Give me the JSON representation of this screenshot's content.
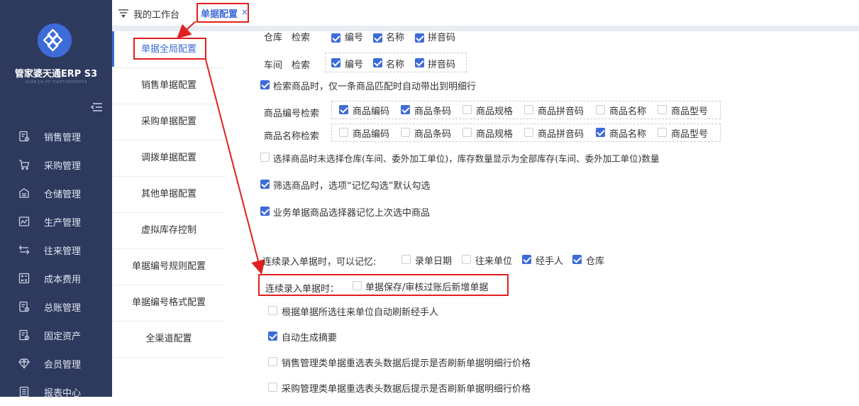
{
  "sidebar": {
    "brand": "管家婆天通ERP S3",
    "brand_sub": "GUAN JIA PO TIANTONGERPS3",
    "items": [
      {
        "label": "销售管理",
        "icon": "receipt-icon"
      },
      {
        "label": "采购管理",
        "icon": "cart-icon"
      },
      {
        "label": "仓储管理",
        "icon": "warehouse-icon"
      },
      {
        "label": "生产管理",
        "icon": "factory-icon"
      },
      {
        "label": "往来管理",
        "icon": "exchange-icon"
      },
      {
        "label": "成本费用",
        "icon": "calculator-icon"
      },
      {
        "label": "总账管理",
        "icon": "ledger-icon"
      },
      {
        "label": "固定资产",
        "icon": "asset-icon"
      },
      {
        "label": "会员管理",
        "icon": "diamond-icon"
      },
      {
        "label": "报表中心",
        "icon": "report-icon"
      }
    ]
  },
  "tabs": {
    "home": "我的工作台",
    "active": "单据配置",
    "close": "×"
  },
  "config_menu": [
    "单据全局配置",
    "销售单据配置",
    "采购单据配置",
    "调拨单据配置",
    "其他单据配置",
    "虚拟库存控制",
    "单据编号规则配置",
    "单据编号格式配置",
    "全渠道配置"
  ],
  "options": {
    "warehouse_row": {
      "label": "仓库　检索",
      "items": [
        "编号",
        "名称",
        "拼音码"
      ]
    },
    "workshop_row": {
      "label": "车间　检索",
      "items": [
        {
          "label": "编号",
          "checked": true
        },
        {
          "label": "名称",
          "checked": true
        },
        {
          "label": "拼音码",
          "checked": true
        }
      ]
    },
    "single_match": {
      "label": "检索商品时，仅一条商品匹配时自动带出到明细行",
      "checked": true
    },
    "code_search": {
      "label": "商品编号检索",
      "items": [
        {
          "label": "商品编码",
          "checked": true
        },
        {
          "label": "商品条码",
          "checked": true
        },
        {
          "label": "商品规格",
          "checked": false
        },
        {
          "label": "商品拼音码",
          "checked": false
        },
        {
          "label": "商品名称",
          "checked": false
        },
        {
          "label": "商品型号",
          "checked": false
        }
      ]
    },
    "name_search": {
      "label": "商品名称检索",
      "items": [
        {
          "label": "商品编码",
          "checked": false
        },
        {
          "label": "商品条码",
          "checked": false
        },
        {
          "label": "商品规格",
          "checked": false
        },
        {
          "label": "商品拼音码",
          "checked": false
        },
        {
          "label": "商品名称",
          "checked": true
        },
        {
          "label": "商品型号",
          "checked": false
        }
      ]
    },
    "all_stock": {
      "label": "选择商品时未选择仓库(车间、委外加工单位)，库存数量显示为全部库存(车间、委外加工单位)数量",
      "checked": false
    },
    "filter_memory": {
      "label": "筛选商品时，选项“记忆勾选”默认勾选",
      "checked": true
    },
    "selector_memory": {
      "label": "业务单据商品选择器记忆上次选中商品",
      "checked": true
    },
    "continuous_memory": {
      "label": "连续录入单据时，可以记忆:",
      "items": [
        {
          "label": "录单日期",
          "checked": false
        },
        {
          "label": "往来单位",
          "checked": false
        },
        {
          "label": "经手人",
          "checked": true
        },
        {
          "label": "仓库",
          "checked": true
        }
      ]
    },
    "continuous_new": {
      "label": "连续录入单据时：",
      "item": "单据保存/审核过账后新增单据",
      "checked": false
    },
    "auto_refresh_handler": {
      "label": "根据单据所选往来单位自动刷新经手人",
      "checked": false
    },
    "auto_summary": {
      "label": "自动生成摘要",
      "checked": true
    },
    "sales_refresh_price": {
      "label": "销售管理类单据重选表头数据后提示是否刷新单据明细行价格",
      "checked": false
    },
    "purchase_refresh_price": {
      "label": "采购管理类单据重选表头数据后提示是否刷新单据明细行价格",
      "checked": false
    }
  },
  "colors": {
    "sidebar": "#2d3a5e",
    "accent": "#3d6bd8",
    "annotation": "#e02020"
  }
}
